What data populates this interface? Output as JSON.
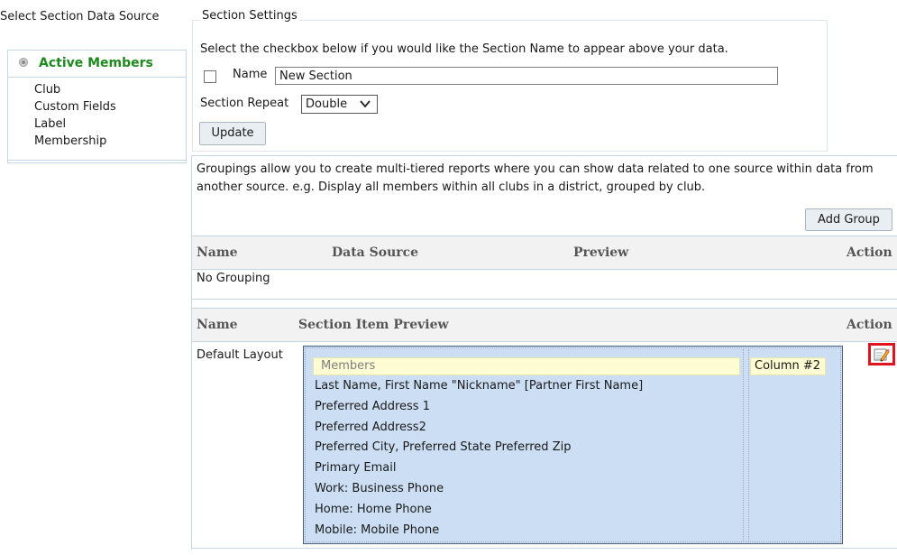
{
  "data_source": {
    "title": "Select Section Data Source",
    "active": "Active Members",
    "items": [
      "Club",
      "Custom Fields",
      "Label",
      "Membership"
    ]
  },
  "section_settings": {
    "legend": "Section Settings",
    "description": "Select the checkbox below if you would like the Section Name to appear above your data.",
    "name_label": "Name",
    "name_value": "New Section",
    "name_checked": false,
    "repeat_label": "Section Repeat",
    "repeat_value": "Double",
    "update_label": "Update"
  },
  "groupings": {
    "description": "Groupings allow you to create multi-tiered reports where you can show data related to one source within data from another source. e.g. Display all members within all clubs in a district, grouped by club.",
    "add_label": "Add Group",
    "columns": [
      "Name",
      "Data Source",
      "Preview",
      "Action"
    ],
    "empty_text": "No Grouping"
  },
  "section_items": {
    "columns": [
      "Name",
      "Section Item Preview",
      "Action"
    ],
    "row_name": "Default Layout",
    "preview_header": "Members",
    "preview_lines": [
      "Last Name, First Name \"Nickname\" [Partner First Name]",
      "Preferred Address 1",
      "Preferred Address2",
      "Preferred City, Preferred State Preferred Zip",
      "Primary Email",
      "Work: Business Phone",
      "Home: Home Phone",
      "Mobile: Mobile Phone"
    ],
    "column2_label": "Column #2",
    "action_icon": "edit-icon"
  }
}
